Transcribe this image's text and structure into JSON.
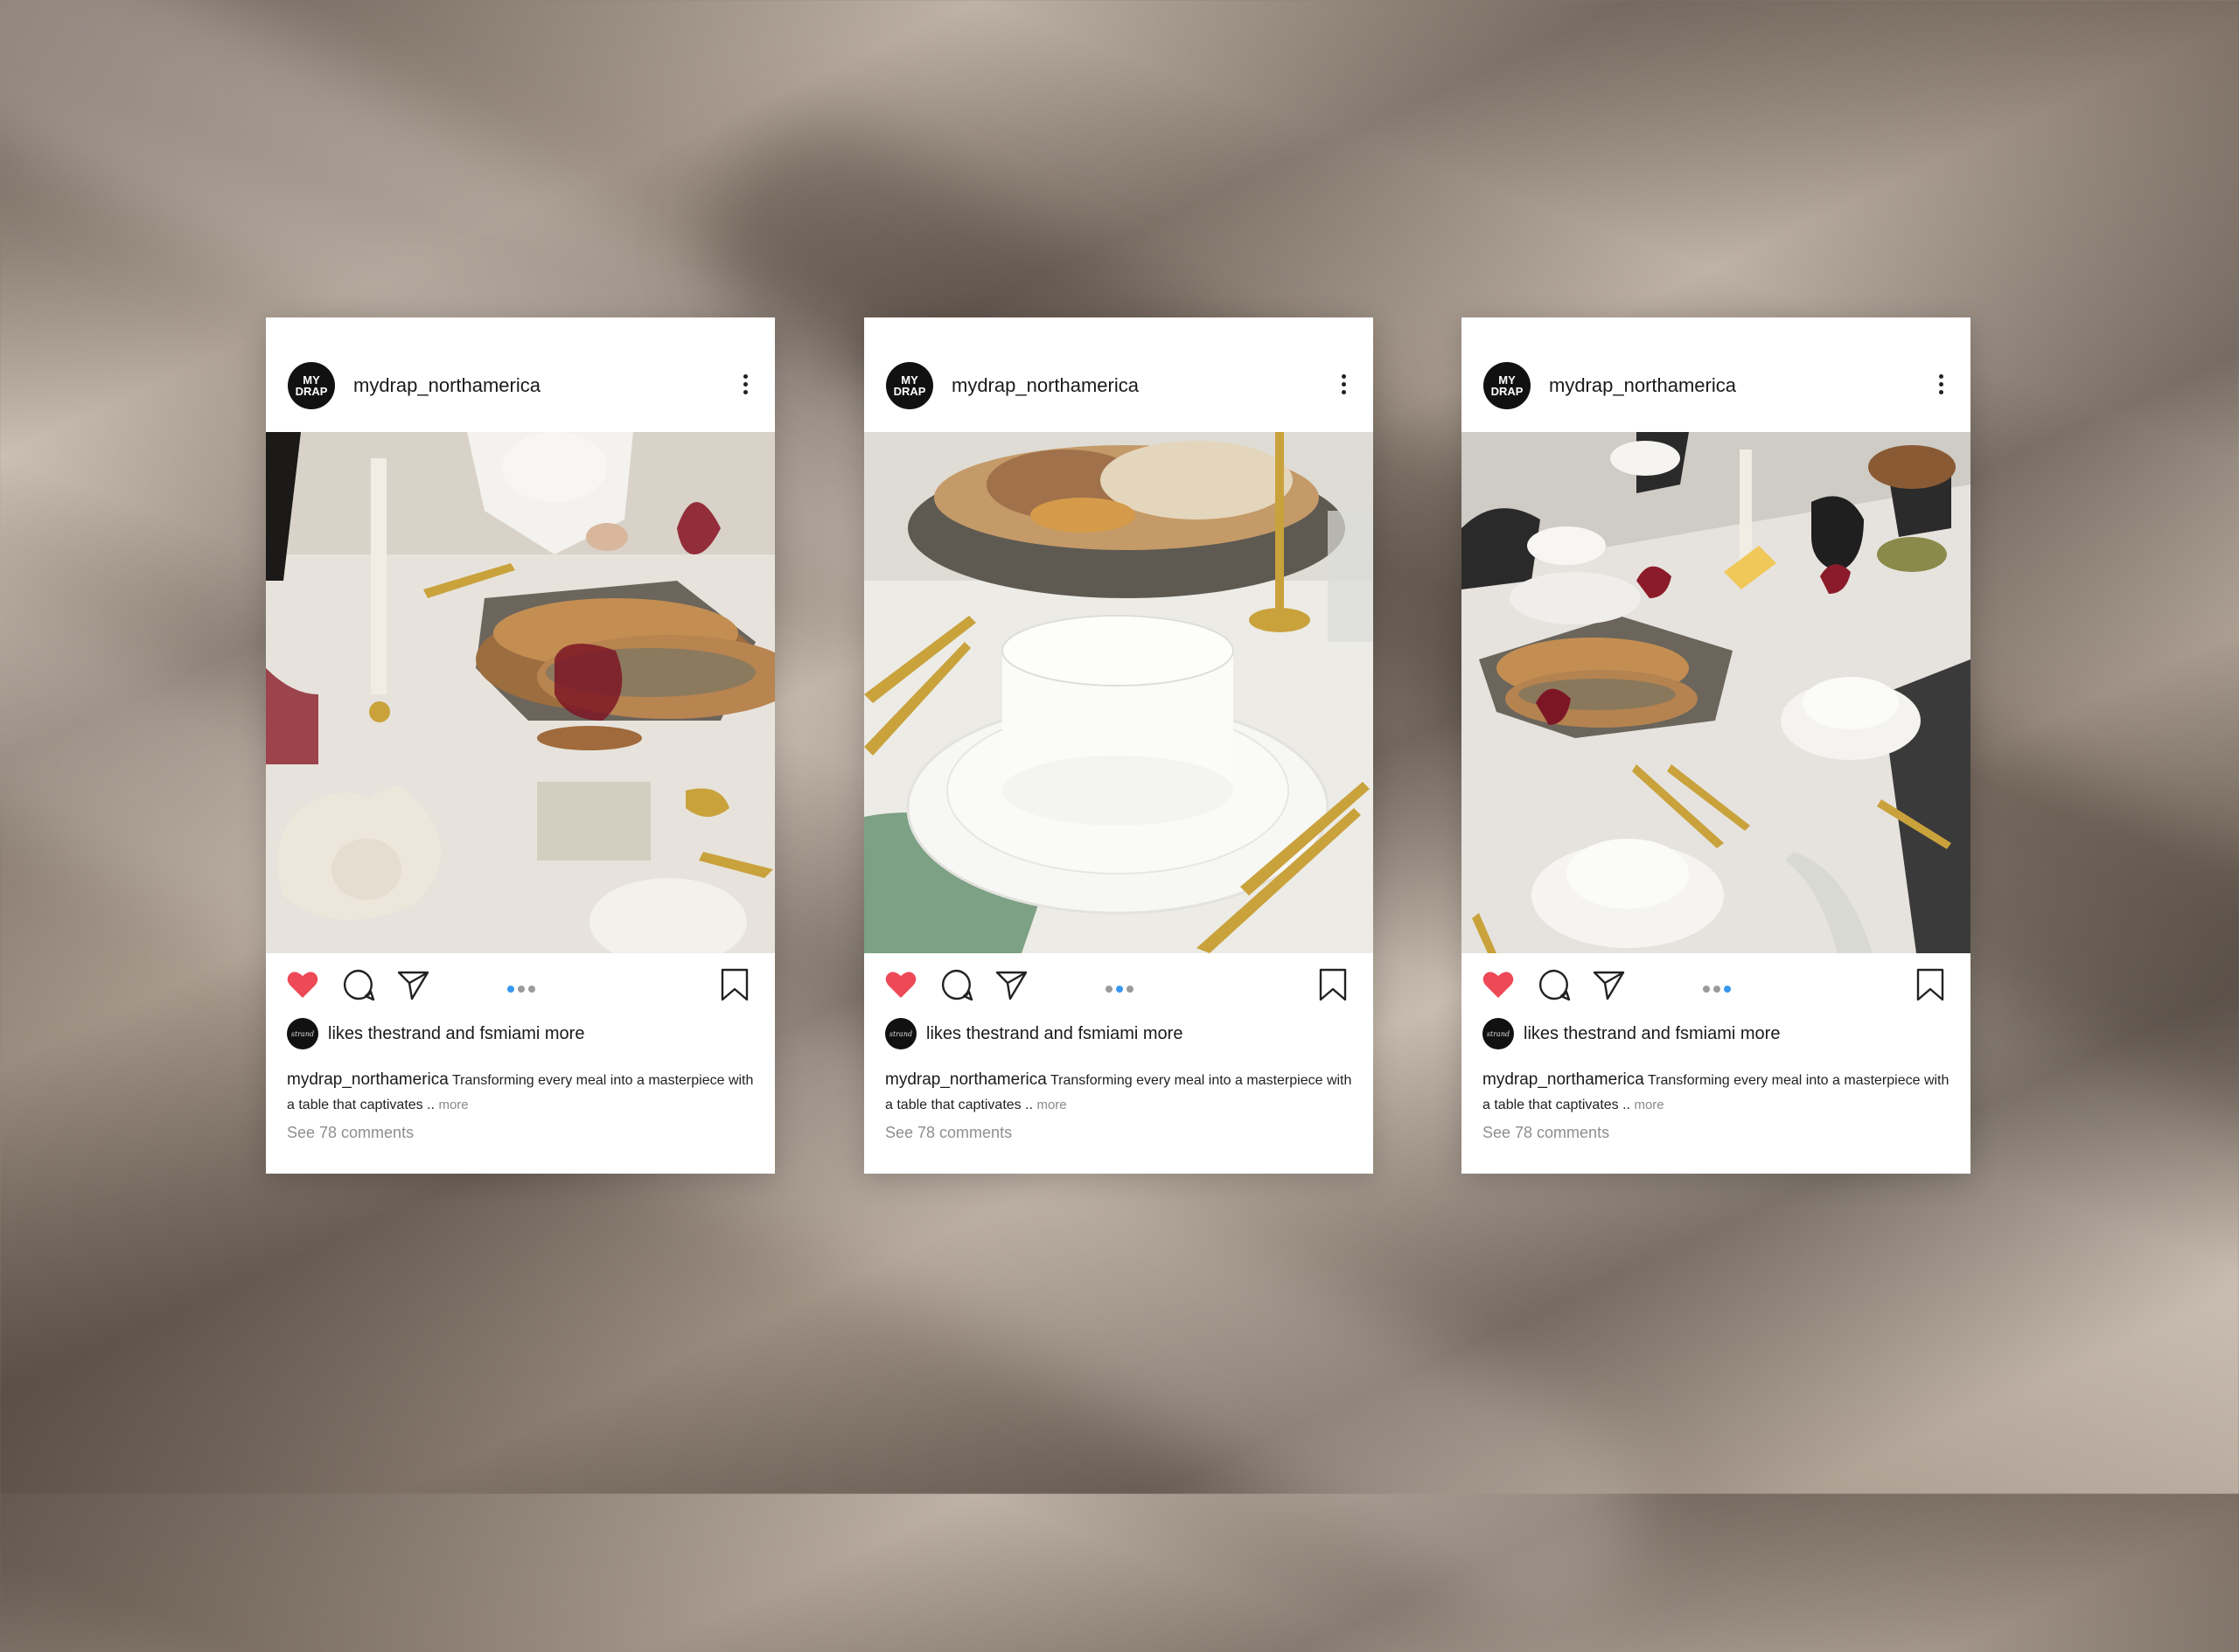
{
  "posts": [
    {
      "avatar_text": "MY DRAP",
      "username": "mydrap_northamerica",
      "photo_alt": "photo 1",
      "liker_avatar_text": "strand",
      "likes_text": "likes thestrand and fsmiami more",
      "caption_user": "mydrap_northamerica",
      "caption_text": "Transforming every meal into a masterpiece with a table that captivates ..",
      "caption_more": "more",
      "comments_text": "See 78 comments",
      "carousel_active": 0
    },
    {
      "avatar_text": "MY DRAP",
      "username": "mydrap_northamerica",
      "photo_alt": "photo 2",
      "liker_avatar_text": "strand",
      "likes_text": "likes thestrand and fsmiami more",
      "caption_user": "mydrap_northamerica",
      "caption_text": "Transforming every meal into a masterpiece with a table that captivates ..",
      "caption_more": "more",
      "comments_text": "See 78 comments",
      "carousel_active": 1
    },
    {
      "avatar_text": "MY DRAP",
      "username": "mydrap_northamerica",
      "photo_alt": "photo 3",
      "liker_avatar_text": "strand",
      "likes_text": "likes thestrand and fsmiami more",
      "caption_user": "mydrap_northamerica",
      "caption_text": "Transforming every meal into a masterpiece with a table that captivates ..",
      "caption_more": "more",
      "comments_text": "See 78 comments",
      "carousel_active": 2
    }
  ],
  "icons": {
    "like": "heart-icon",
    "comment": "comment-icon",
    "share": "share-icon",
    "save": "bookmark-icon",
    "menu": "more-vertical-icon"
  },
  "colors": {
    "like": "#ed4956",
    "carousel_active": "#3897f0",
    "carousel_inactive": "#9a9a9a"
  }
}
